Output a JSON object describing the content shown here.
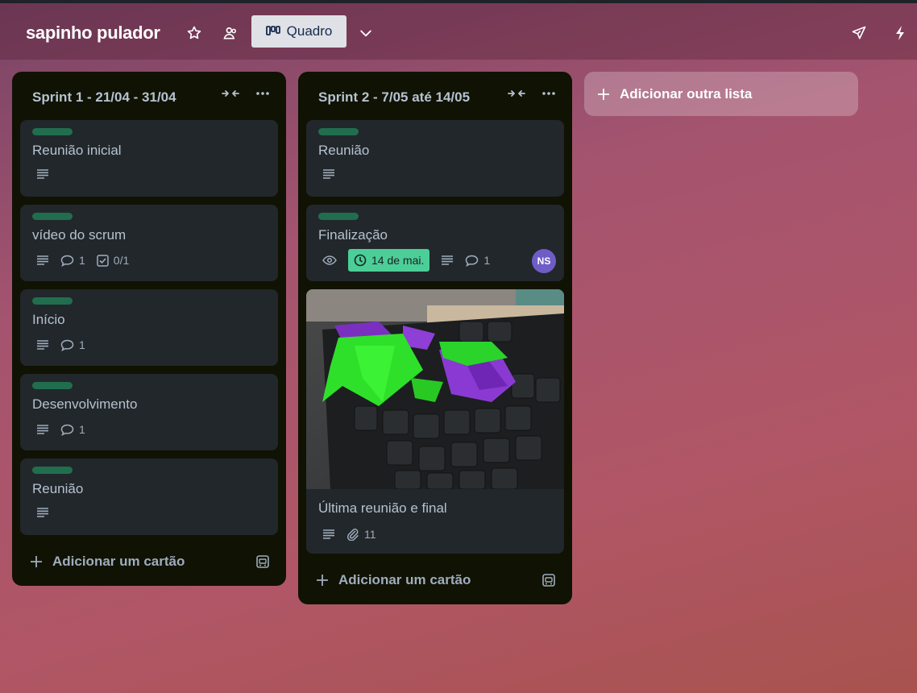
{
  "board": {
    "title": "sapinho pulador",
    "view_label": "Quadro"
  },
  "lists": [
    {
      "title": "Sprint 1 - 21/04 - 31/04",
      "add_card_label": "Adicionar um cartão",
      "cards": [
        {
          "title": "Reunião inicial"
        },
        {
          "title": "vídeo do scrum",
          "comments": "1",
          "checklist": "0/1"
        },
        {
          "title": "Início",
          "comments": "1"
        },
        {
          "title": "Desenvolvimento",
          "comments": "1"
        },
        {
          "title": "Reunião"
        }
      ]
    },
    {
      "title": "Sprint 2 - 7/05 até 14/05",
      "add_card_label": "Adicionar um cartão",
      "cards": [
        {
          "title": "Reunião"
        },
        {
          "title": "Finalização",
          "due": "14 de mai.",
          "comments": "1",
          "member_initials": "NS"
        },
        {
          "title": "Última reunião e final",
          "attachments": "11"
        }
      ]
    }
  ],
  "add_list_label": "Adicionar outra lista",
  "colors": {
    "label_green": "#216e4e",
    "due_badge": "#4bce97",
    "avatar": "#6e5dc6",
    "list_bg": "#101204",
    "card_bg": "#22272b"
  }
}
